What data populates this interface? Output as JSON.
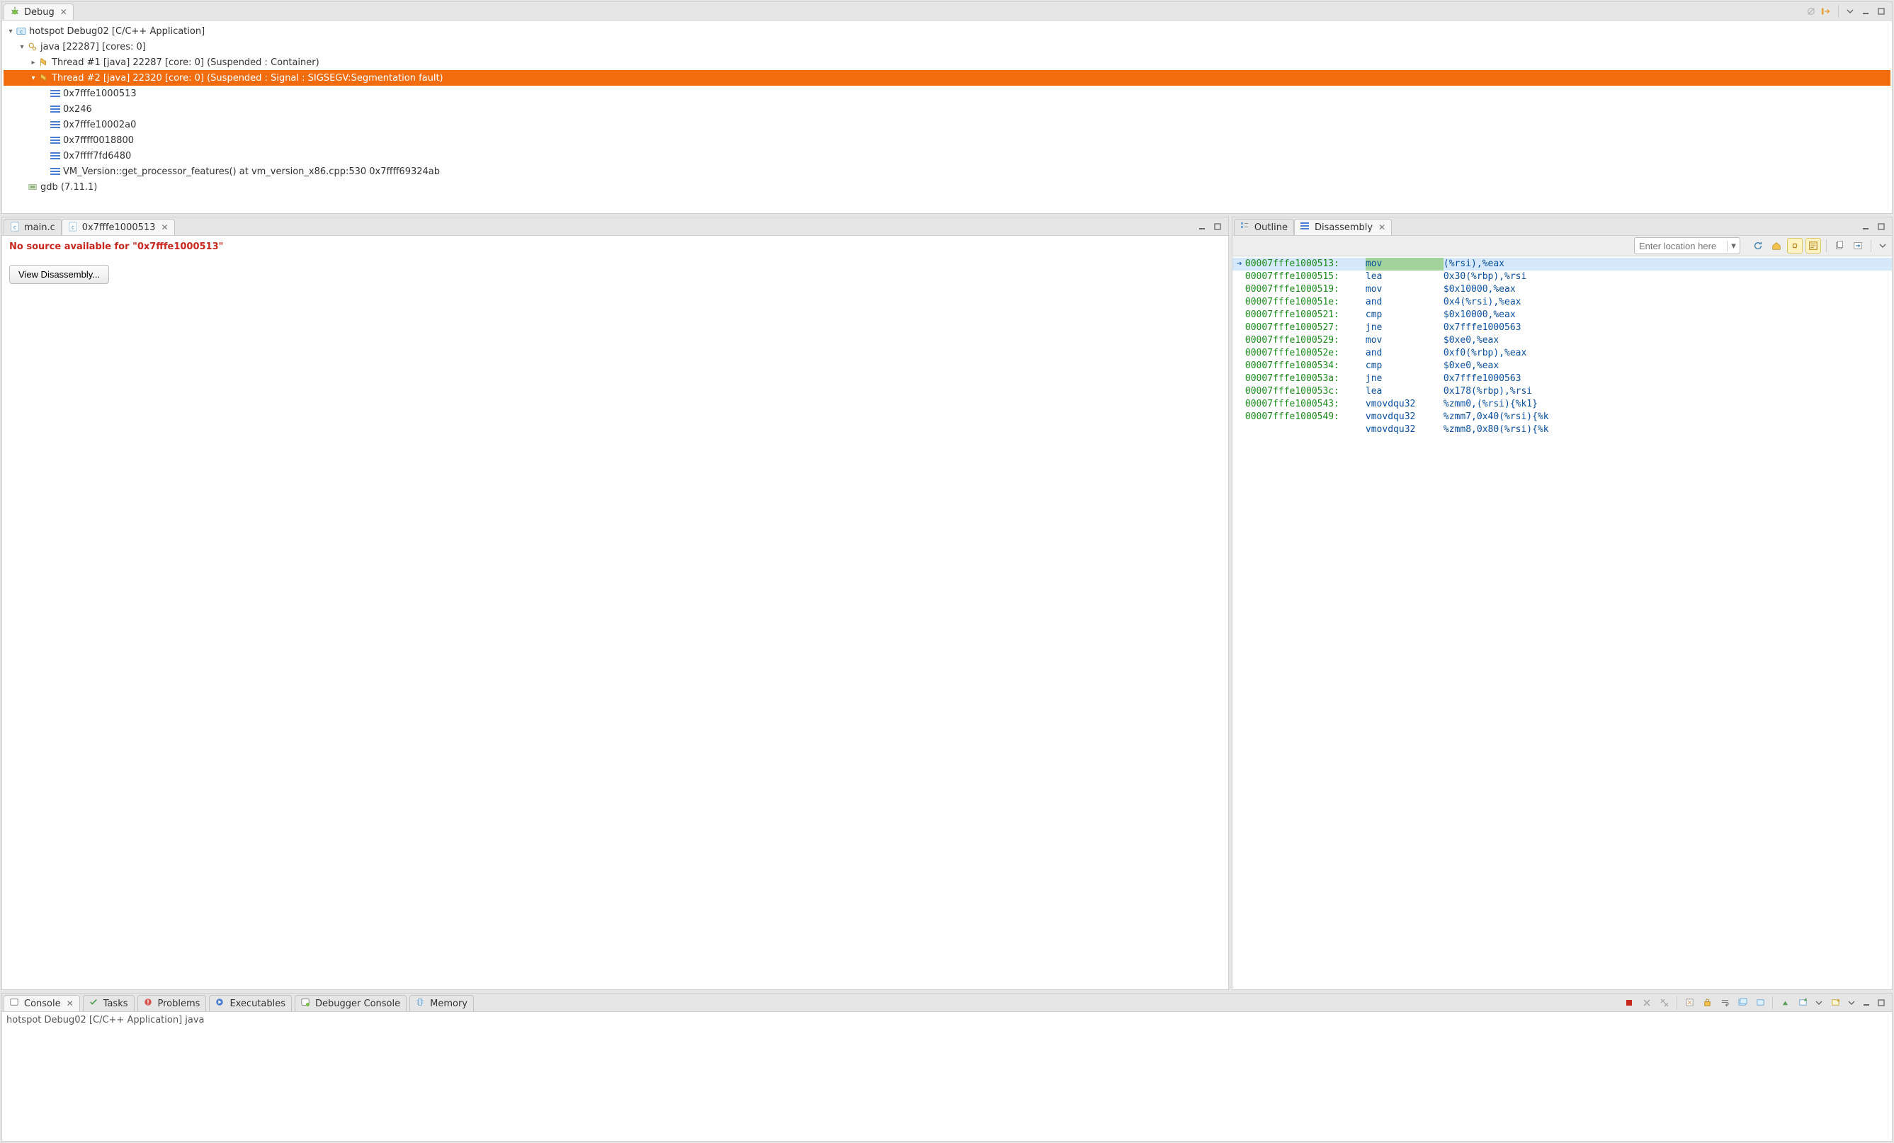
{
  "debug_view": {
    "tab_label": "Debug",
    "tree": {
      "launch": "hotspot Debug02 [C/C++ Application]",
      "process": "java [22287] [cores: 0]",
      "thread1": "Thread #1 [java] 22287 [core: 0] (Suspended : Container)",
      "thread2": "Thread #2 [java] 22320 [core: 0] (Suspended : Signal : SIGSEGV:Segmentation fault)",
      "frames": [
        "0x7fffe1000513",
        "0x246",
        "0x7fffe10002a0",
        "0x7ffff0018800",
        "0x7ffff7fd6480",
        "VM_Version::get_processor_features() at vm_version_x86.cpp:530 0x7ffff69324ab"
      ],
      "gdb": "gdb (7.11.1)"
    }
  },
  "editor": {
    "tabs": {
      "main": "main.c",
      "addr": "0x7fffe1000513"
    },
    "error_prefix": "No source available for ",
    "error_addr": "\"0x7fffe1000513\"",
    "view_disassembly_btn": "View Disassembly..."
  },
  "right": {
    "outline_tab": "Outline",
    "disasm_tab": "Disassembly",
    "location_placeholder": "Enter location here",
    "lines": [
      {
        "addr": "00007fffe1000513:",
        "op": "mov",
        "args": "(%rsi),%eax",
        "current": true
      },
      {
        "addr": "00007fffe1000515:",
        "op": "lea",
        "args": "0x30(%rbp),%rsi"
      },
      {
        "addr": "00007fffe1000519:",
        "op": "mov",
        "args": "$0x10000,%eax"
      },
      {
        "addr": "00007fffe100051e:",
        "op": "and",
        "args": "0x4(%rsi),%eax"
      },
      {
        "addr": "00007fffe1000521:",
        "op": "cmp",
        "args": "$0x10000,%eax"
      },
      {
        "addr": "00007fffe1000527:",
        "op": "jne",
        "args": "0x7fffe1000563"
      },
      {
        "addr": "00007fffe1000529:",
        "op": "mov",
        "args": "$0xe0,%eax"
      },
      {
        "addr": "00007fffe100052e:",
        "op": "and",
        "args": "0xf0(%rbp),%eax"
      },
      {
        "addr": "00007fffe1000534:",
        "op": "cmp",
        "args": "$0xe0,%eax"
      },
      {
        "addr": "00007fffe100053a:",
        "op": "jne",
        "args": "0x7fffe1000563"
      },
      {
        "addr": "00007fffe100053c:",
        "op": "lea",
        "args": "0x178(%rbp),%rsi"
      },
      {
        "addr": "00007fffe1000543:",
        "op": "vmovdqu32",
        "args": "%zmm0,(%rsi){%k1}"
      },
      {
        "addr": "00007fffe1000549:",
        "op": "vmovdqu32",
        "args": "%zmm7,0x40(%rsi){%k"
      },
      {
        "addr": "",
        "op": "vmovdqu32",
        "args": "%zmm8,0x80(%rsi){%k",
        "partial": true
      }
    ]
  },
  "bottom": {
    "tabs": {
      "console": "Console",
      "tasks": "Tasks",
      "problems": "Problems",
      "executables": "Executables",
      "debugger_console": "Debugger Console",
      "memory": "Memory"
    },
    "console_text": "hotspot Debug02 [C/C++ Application] java"
  }
}
